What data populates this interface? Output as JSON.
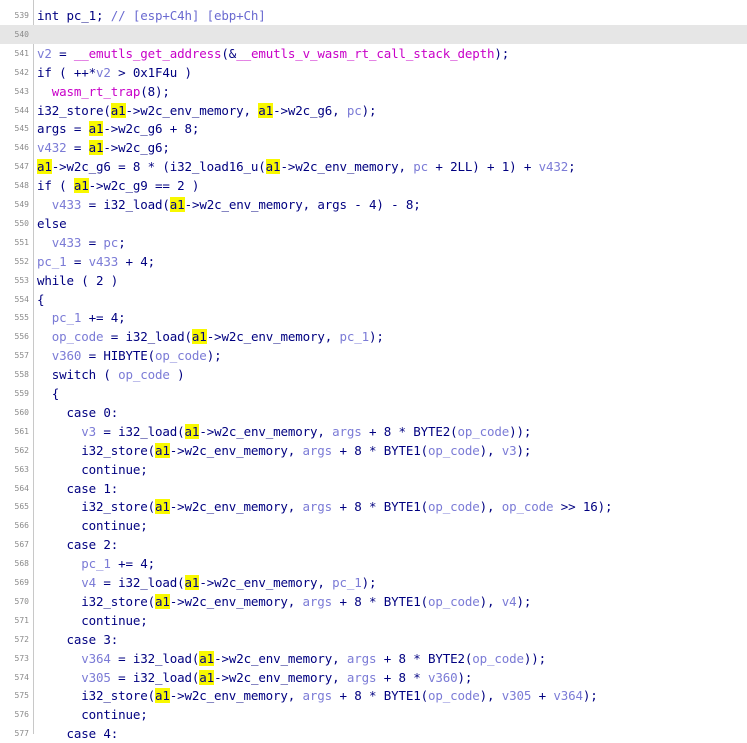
{
  "editor": {
    "lines": [
      {
        "n": "539",
        "hl": false,
        "seg": [
          {
            "t": "int pc_1; ",
            "c": "tk"
          },
          {
            "t": "// [esp+C4h] [ebp+Ch]",
            "c": "cm"
          }
        ]
      },
      {
        "n": "540",
        "hl": true,
        "seg": []
      },
      {
        "n": "541",
        "hl": false,
        "seg": [
          {
            "t": "v2",
            "c": "c"
          },
          {
            "t": " = ",
            "c": "tk"
          },
          {
            "t": "__emutls_get_address",
            "c": "fn"
          },
          {
            "t": "(&",
            "c": "tk"
          },
          {
            "t": "__emutls_v_wasm_rt_call_stack_depth",
            "c": "fn"
          },
          {
            "t": ");",
            "c": "tk"
          }
        ]
      },
      {
        "n": "542",
        "hl": false,
        "seg": [
          {
            "t": "if ( ++*",
            "c": "tk"
          },
          {
            "t": "v2",
            "c": "c"
          },
          {
            "t": " > 0x1F4u )",
            "c": "tk"
          }
        ]
      },
      {
        "n": "543",
        "hl": false,
        "seg": [
          {
            "t": "  ",
            "c": "tk"
          },
          {
            "t": "wasm_rt_trap",
            "c": "fn"
          },
          {
            "t": "(8);",
            "c": "tk"
          }
        ]
      },
      {
        "n": "544",
        "hl": false,
        "seg": [
          {
            "t": "i32_store(",
            "c": "tk"
          },
          {
            "t": "a1",
            "c": "hi"
          },
          {
            "t": "->w2c_env_memory, ",
            "c": "tk"
          },
          {
            "t": "a1",
            "c": "hi"
          },
          {
            "t": "->w2c_g6, ",
            "c": "tk"
          },
          {
            "t": "pc",
            "c": "c"
          },
          {
            "t": ");",
            "c": "tk"
          }
        ]
      },
      {
        "n": "545",
        "hl": false,
        "seg": [
          {
            "t": "args = ",
            "c": "tk"
          },
          {
            "t": "a1",
            "c": "hi"
          },
          {
            "t": "->w2c_g6 + 8;",
            "c": "tk"
          }
        ]
      },
      {
        "n": "546",
        "hl": false,
        "seg": [
          {
            "t": "v432",
            "c": "c"
          },
          {
            "t": " = ",
            "c": "tk"
          },
          {
            "t": "a1",
            "c": "hi"
          },
          {
            "t": "->w2c_g6;",
            "c": "tk"
          }
        ]
      },
      {
        "n": "547",
        "hl": false,
        "seg": [
          {
            "t": "a1",
            "c": "hi"
          },
          {
            "t": "->w2c_g6 = 8 * (i32_load16_u(",
            "c": "tk"
          },
          {
            "t": "a1",
            "c": "hi"
          },
          {
            "t": "->w2c_env_memory, ",
            "c": "tk"
          },
          {
            "t": "pc",
            "c": "c"
          },
          {
            "t": " + 2LL) + 1) + ",
            "c": "tk"
          },
          {
            "t": "v432",
            "c": "c"
          },
          {
            "t": ";",
            "c": "tk"
          }
        ]
      },
      {
        "n": "548",
        "hl": false,
        "seg": [
          {
            "t": "if ( ",
            "c": "tk"
          },
          {
            "t": "a1",
            "c": "hi"
          },
          {
            "t": "->w2c_g9 == 2 )",
            "c": "tk"
          }
        ]
      },
      {
        "n": "549",
        "hl": false,
        "seg": [
          {
            "t": "  ",
            "c": "tk"
          },
          {
            "t": "v433",
            "c": "c"
          },
          {
            "t": " = i32_load(",
            "c": "tk"
          },
          {
            "t": "a1",
            "c": "hi"
          },
          {
            "t": "->w2c_env_memory, args - 4) - 8;",
            "c": "tk"
          }
        ]
      },
      {
        "n": "550",
        "hl": false,
        "seg": [
          {
            "t": "else",
            "c": "tk"
          }
        ]
      },
      {
        "n": "551",
        "hl": false,
        "seg": [
          {
            "t": "  ",
            "c": "tk"
          },
          {
            "t": "v433",
            "c": "c"
          },
          {
            "t": " = ",
            "c": "tk"
          },
          {
            "t": "pc",
            "c": "c"
          },
          {
            "t": ";",
            "c": "tk"
          }
        ]
      },
      {
        "n": "552",
        "hl": false,
        "seg": [
          {
            "t": "pc_1",
            "c": "c"
          },
          {
            "t": " = ",
            "c": "tk"
          },
          {
            "t": "v433",
            "c": "c"
          },
          {
            "t": " + 4;",
            "c": "tk"
          }
        ]
      },
      {
        "n": "553",
        "hl": false,
        "seg": [
          {
            "t": "while ( 2 )",
            "c": "tk"
          }
        ]
      },
      {
        "n": "554",
        "hl": false,
        "seg": [
          {
            "t": "{",
            "c": "tk"
          }
        ]
      },
      {
        "n": "555",
        "hl": false,
        "seg": [
          {
            "t": "  ",
            "c": "tk"
          },
          {
            "t": "pc_1",
            "c": "c"
          },
          {
            "t": " += 4;",
            "c": "tk"
          }
        ]
      },
      {
        "n": "556",
        "hl": false,
        "seg": [
          {
            "t": "  ",
            "c": "tk"
          },
          {
            "t": "op_code",
            "c": "c"
          },
          {
            "t": " = i32_load(",
            "c": "tk"
          },
          {
            "t": "a1",
            "c": "hi"
          },
          {
            "t": "->w2c_env_memory, ",
            "c": "tk"
          },
          {
            "t": "pc_1",
            "c": "c"
          },
          {
            "t": ");",
            "c": "tk"
          }
        ]
      },
      {
        "n": "557",
        "hl": false,
        "seg": [
          {
            "t": "  ",
            "c": "tk"
          },
          {
            "t": "v360",
            "c": "c"
          },
          {
            "t": " = HIBYTE(",
            "c": "tk"
          },
          {
            "t": "op_code",
            "c": "c"
          },
          {
            "t": ");",
            "c": "tk"
          }
        ]
      },
      {
        "n": "558",
        "hl": false,
        "seg": [
          {
            "t": "  switch ( ",
            "c": "tk"
          },
          {
            "t": "op_code",
            "c": "c"
          },
          {
            "t": " )",
            "c": "tk"
          }
        ]
      },
      {
        "n": "559",
        "hl": false,
        "seg": [
          {
            "t": "  {",
            "c": "tk"
          }
        ]
      },
      {
        "n": "560",
        "hl": false,
        "seg": [
          {
            "t": "    case 0:",
            "c": "tk"
          }
        ]
      },
      {
        "n": "561",
        "hl": false,
        "seg": [
          {
            "t": "      ",
            "c": "tk"
          },
          {
            "t": "v3",
            "c": "c"
          },
          {
            "t": " = i32_load(",
            "c": "tk"
          },
          {
            "t": "a1",
            "c": "hi"
          },
          {
            "t": "->w2c_env_memory, ",
            "c": "tk"
          },
          {
            "t": "args",
            "c": "c"
          },
          {
            "t": " + 8 * BYTE2(",
            "c": "tk"
          },
          {
            "t": "op_code",
            "c": "c"
          },
          {
            "t": "));",
            "c": "tk"
          }
        ]
      },
      {
        "n": "562",
        "hl": false,
        "seg": [
          {
            "t": "      i32_store(",
            "c": "tk"
          },
          {
            "t": "a1",
            "c": "hi"
          },
          {
            "t": "->w2c_env_memory, ",
            "c": "tk"
          },
          {
            "t": "args",
            "c": "c"
          },
          {
            "t": " + 8 * BYTE1(",
            "c": "tk"
          },
          {
            "t": "op_code",
            "c": "c"
          },
          {
            "t": "), ",
            "c": "tk"
          },
          {
            "t": "v3",
            "c": "c"
          },
          {
            "t": ");",
            "c": "tk"
          }
        ]
      },
      {
        "n": "563",
        "hl": false,
        "seg": [
          {
            "t": "      continue;",
            "c": "tk"
          }
        ]
      },
      {
        "n": "564",
        "hl": false,
        "seg": [
          {
            "t": "    case 1:",
            "c": "tk"
          }
        ]
      },
      {
        "n": "565",
        "hl": false,
        "seg": [
          {
            "t": "      i32_store(",
            "c": "tk"
          },
          {
            "t": "a1",
            "c": "hi"
          },
          {
            "t": "->w2c_env_memory, ",
            "c": "tk"
          },
          {
            "t": "args",
            "c": "c"
          },
          {
            "t": " + 8 * BYTE1(",
            "c": "tk"
          },
          {
            "t": "op_code",
            "c": "c"
          },
          {
            "t": "), ",
            "c": "tk"
          },
          {
            "t": "op_code",
            "c": "c"
          },
          {
            "t": " >> 16);",
            "c": "tk"
          }
        ]
      },
      {
        "n": "566",
        "hl": false,
        "seg": [
          {
            "t": "      continue;",
            "c": "tk"
          }
        ]
      },
      {
        "n": "567",
        "hl": false,
        "seg": [
          {
            "t": "    case 2:",
            "c": "tk"
          }
        ]
      },
      {
        "n": "568",
        "hl": false,
        "seg": [
          {
            "t": "      ",
            "c": "tk"
          },
          {
            "t": "pc_1",
            "c": "c"
          },
          {
            "t": " += 4;",
            "c": "tk"
          }
        ]
      },
      {
        "n": "569",
        "hl": false,
        "seg": [
          {
            "t": "      ",
            "c": "tk"
          },
          {
            "t": "v4",
            "c": "c"
          },
          {
            "t": " = i32_load(",
            "c": "tk"
          },
          {
            "t": "a1",
            "c": "hi"
          },
          {
            "t": "->w2c_env_memory, ",
            "c": "tk"
          },
          {
            "t": "pc_1",
            "c": "c"
          },
          {
            "t": ");",
            "c": "tk"
          }
        ]
      },
      {
        "n": "570",
        "hl": false,
        "seg": [
          {
            "t": "      i32_store(",
            "c": "tk"
          },
          {
            "t": "a1",
            "c": "hi"
          },
          {
            "t": "->w2c_env_memory, ",
            "c": "tk"
          },
          {
            "t": "args",
            "c": "c"
          },
          {
            "t": " + 8 * BYTE1(",
            "c": "tk"
          },
          {
            "t": "op_code",
            "c": "c"
          },
          {
            "t": "), ",
            "c": "tk"
          },
          {
            "t": "v4",
            "c": "c"
          },
          {
            "t": ");",
            "c": "tk"
          }
        ]
      },
      {
        "n": "571",
        "hl": false,
        "seg": [
          {
            "t": "      continue;",
            "c": "tk"
          }
        ]
      },
      {
        "n": "572",
        "hl": false,
        "seg": [
          {
            "t": "    case 3:",
            "c": "tk"
          }
        ]
      },
      {
        "n": "573",
        "hl": false,
        "seg": [
          {
            "t": "      ",
            "c": "tk"
          },
          {
            "t": "v364",
            "c": "c"
          },
          {
            "t": " = i32_load(",
            "c": "tk"
          },
          {
            "t": "a1",
            "c": "hi"
          },
          {
            "t": "->w2c_env_memory, ",
            "c": "tk"
          },
          {
            "t": "args",
            "c": "c"
          },
          {
            "t": " + 8 * BYTE2(",
            "c": "tk"
          },
          {
            "t": "op_code",
            "c": "c"
          },
          {
            "t": "));",
            "c": "tk"
          }
        ]
      },
      {
        "n": "574",
        "hl": false,
        "seg": [
          {
            "t": "      ",
            "c": "tk"
          },
          {
            "t": "v305",
            "c": "c"
          },
          {
            "t": " = i32_load(",
            "c": "tk"
          },
          {
            "t": "a1",
            "c": "hi"
          },
          {
            "t": "->w2c_env_memory, ",
            "c": "tk"
          },
          {
            "t": "args",
            "c": "c"
          },
          {
            "t": " + 8 * ",
            "c": "tk"
          },
          {
            "t": "v360",
            "c": "c"
          },
          {
            "t": ");",
            "c": "tk"
          }
        ]
      },
      {
        "n": "575",
        "hl": false,
        "seg": [
          {
            "t": "      i32_store(",
            "c": "tk"
          },
          {
            "t": "a1",
            "c": "hi"
          },
          {
            "t": "->w2c_env_memory, ",
            "c": "tk"
          },
          {
            "t": "args",
            "c": "c"
          },
          {
            "t": " + 8 * BYTE1(",
            "c": "tk"
          },
          {
            "t": "op_code",
            "c": "c"
          },
          {
            "t": "), ",
            "c": "tk"
          },
          {
            "t": "v305",
            "c": "c"
          },
          {
            "t": " + ",
            "c": "tk"
          },
          {
            "t": "v364",
            "c": "c"
          },
          {
            "t": ");",
            "c": "tk"
          }
        ]
      },
      {
        "n": "576",
        "hl": false,
        "seg": [
          {
            "t": "      continue;",
            "c": "tk"
          }
        ]
      },
      {
        "n": "577",
        "hl": false,
        "seg": [
          {
            "t": "    case 4:",
            "c": "tk"
          }
        ]
      }
    ]
  }
}
